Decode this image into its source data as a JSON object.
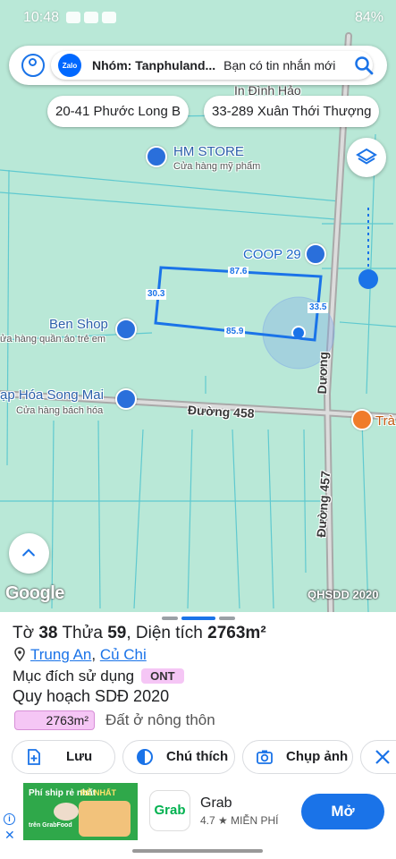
{
  "status_bar": {
    "time": "10:48",
    "battery": "84%"
  },
  "search_bar": {
    "notification_title": "Nhóm: Tanphuland...",
    "notification_message": "Bạn có tin nhắn mới",
    "zalo_label": "Zalo"
  },
  "map": {
    "top_partial_label": "In Đình Hảo",
    "chips": [
      "20-41 Phước Long B",
      "33-289 Xuân Thới Thượng"
    ],
    "pois": [
      {
        "name": "HM STORE",
        "category": "Cửa hàng mỹ phẩm"
      },
      {
        "name": "COOP 29"
      },
      {
        "name": "Ben Shop",
        "category": "ửa hàng quần áo trẻ em"
      },
      {
        "name": "ạp Hóa Song Mai",
        "category": "Cửa hàng bách hóa"
      },
      {
        "name": "Trà"
      }
    ],
    "roads": [
      "Đường 458",
      "Đường 457",
      "Dương"
    ],
    "plot_dimensions": {
      "top": "87.6",
      "left": "30.3",
      "right": "33.5",
      "bottom": "85.9"
    },
    "google_logo": "Google",
    "layer_label": "QHSDD 2020",
    "colors": {
      "plot_outline": "#1a73e8",
      "map_fill": "#b9e8d7",
      "road": "#5bc8d0"
    }
  },
  "sheet": {
    "to_label": "Tờ",
    "to_value": "38",
    "thua_label": "Thửa",
    "thua_value": "59",
    "area_label": ", Diện tích",
    "area_value": "2763m²",
    "location_ward": "Trung An",
    "location_district": "Củ Chi",
    "purpose_label": "Mục đích sử dụng",
    "purpose_code": "ONT",
    "planning_title": "Quy hoạch SDĐ 2020",
    "planning_area": "2763m²",
    "planning_use": "Đất ở nông thôn",
    "actions": [
      {
        "label": "Lưu",
        "icon": "add-doc-icon"
      },
      {
        "label": "Chú thích",
        "icon": "contrast-icon"
      },
      {
        "label": "Chụp ảnh",
        "icon": "camera-icon"
      }
    ]
  },
  "ad": {
    "promo_text": "Phí ship rẻ nhất",
    "promo_sub": "trên GrabFood",
    "promo_badge": "RẺ NHẤT",
    "logo_text": "Grab",
    "app_name": "Grab",
    "rating": "4.7 ★ MIỄN PHÍ",
    "open_button": "Mở",
    "colors": {
      "open_button": "#1a73e8",
      "brand": "#00b14f"
    }
  }
}
